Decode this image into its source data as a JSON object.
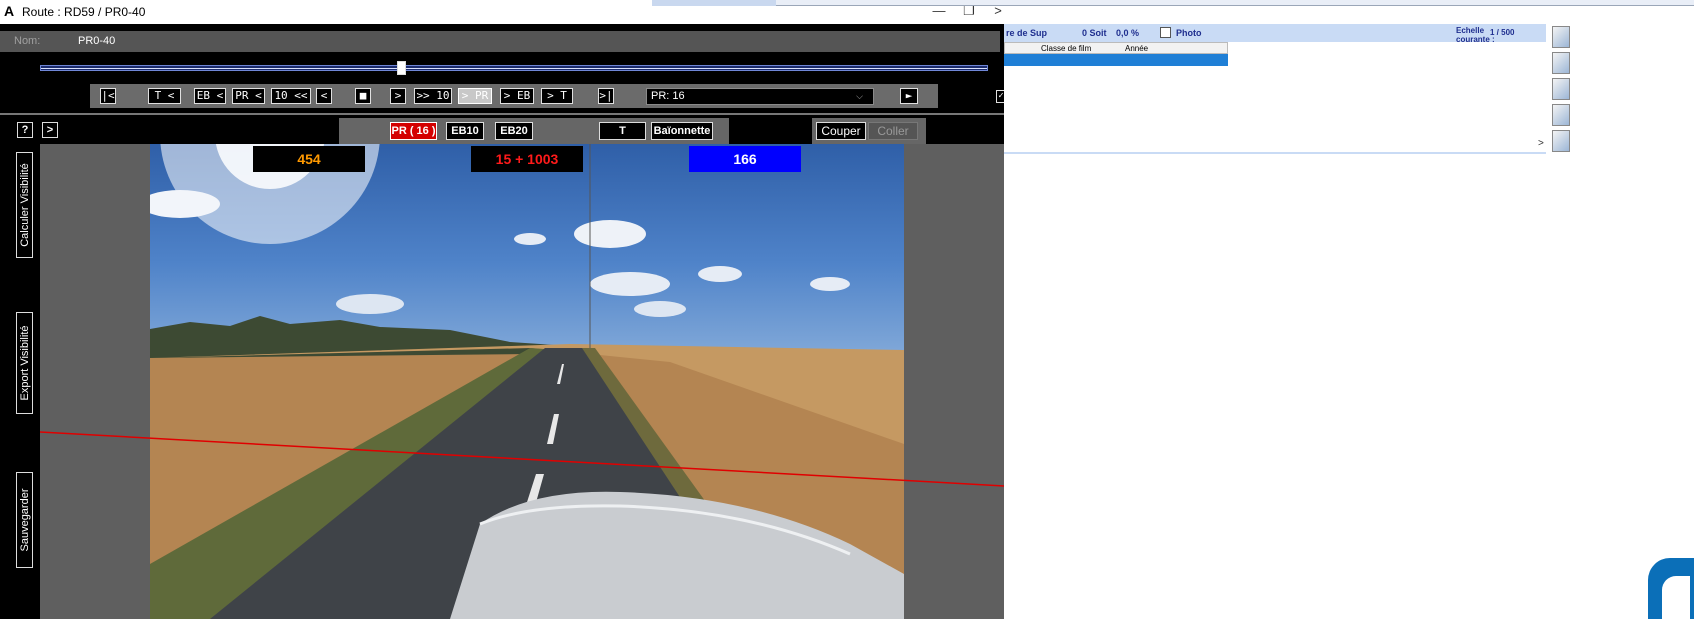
{
  "window": {
    "title": "Route : RD59 / PR0-40",
    "app_icon": "A",
    "minimize": "—",
    "restore": "❐",
    "extra": ">"
  },
  "name_row": {
    "label": "Nom:",
    "value": "PR0-40"
  },
  "slider": {
    "position_fraction": 0.38
  },
  "nav": {
    "first": "|<",
    "t_prev": "T <",
    "eb_prev": "EB <",
    "pr_prev": "PR <",
    "ten_prev": "10 <<",
    "prev": "<",
    "stop": "■",
    "next": ">",
    "ten_next": ">> 10",
    "pr_next": "> PR",
    "eb_next": "> EB",
    "t_next": "> T",
    "last": ">|",
    "pr_select": "PR: 16",
    "play": "►",
    "check": "✓"
  },
  "toolbar": {
    "help": "?",
    "expand": ">",
    "pr_btn": "PR ( 16 )",
    "eb10": "EB10",
    "eb20": "EB20",
    "t_btn": "T",
    "baionnette": "Baïonnette",
    "couper": "Couper",
    "coller": "Coller"
  },
  "sidebar": {
    "calc": "Calculer Visibilité",
    "export": "Export Visibilité",
    "save": "Sauvegarder"
  },
  "counters": [
    {
      "value": "454",
      "color": "#ff9900"
    },
    {
      "value": "15 + 1003",
      "color": "#ff1a1a"
    },
    {
      "value": "166",
      "color": "#ffffff"
    }
  ],
  "right": {
    "strip_left": "re de Sup",
    "soit": "0 Soit",
    "pct": "0,0 %",
    "photo": "Photo",
    "echelle_label": "Echelle courante :",
    "echelle_value": "1 / 500",
    "col1": "Classe de film",
    "col2": "Année",
    "scroll": ">"
  },
  "colors": {
    "accent_blue": "#1f7fd6",
    "pr_red": "#d40000",
    "horizon_line": "#e00000"
  },
  "icons": [
    "chevron-right-icon",
    "chart-icon",
    "table-icon",
    "document-icon",
    "folder-icon",
    "palette-icon"
  ]
}
